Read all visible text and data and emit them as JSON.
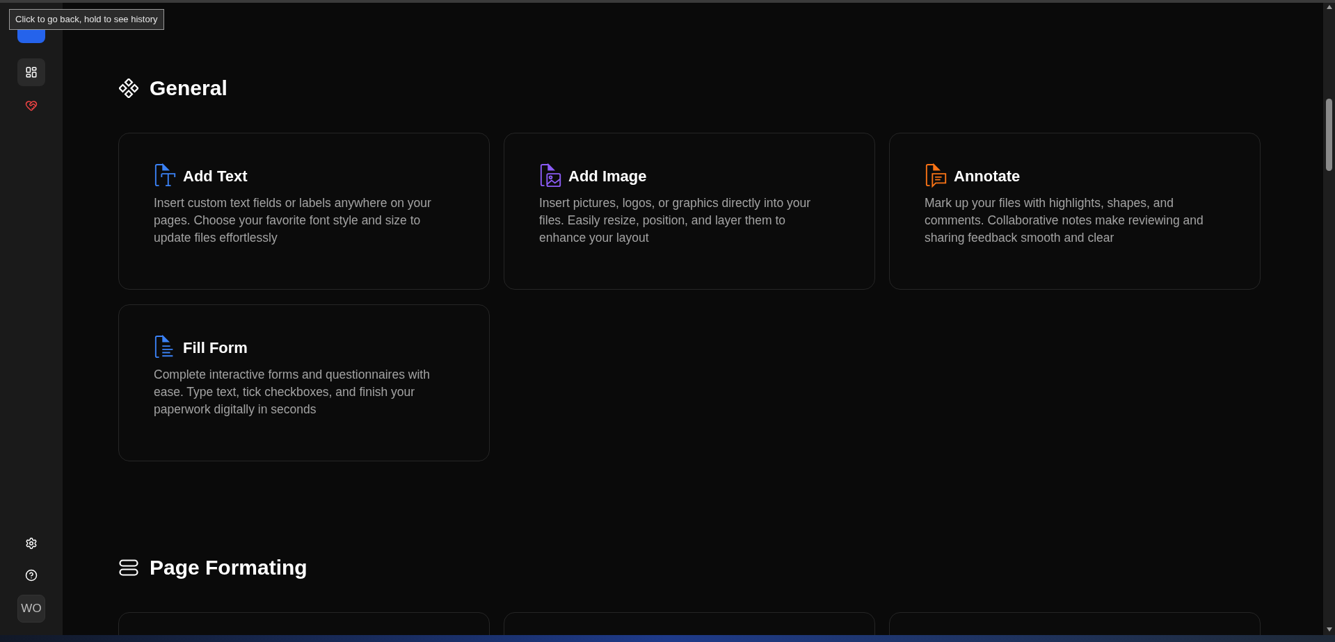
{
  "tooltip": "Click to go back, hold to see history",
  "sidebar": {
    "nav": [
      {
        "kind": "grid",
        "selected": true
      },
      {
        "kind": "heart",
        "selected": false
      }
    ],
    "bottom": [
      {
        "kind": "settings"
      },
      {
        "kind": "help"
      }
    ],
    "profile": "WO"
  },
  "sections": [
    {
      "title": "General",
      "kind": "diamonds",
      "cards": [
        {
          "kind": "text",
          "color": "#3b82f6",
          "title": "Add Text",
          "description": "Insert custom text fields or labels anywhere on your pages. Choose your favorite font style and size to update files effortlessly"
        },
        {
          "kind": "image",
          "color": "#8b5cf6",
          "title": "Add Image",
          "description": "Insert pictures, logos, or graphics directly into your files. Easily resize, position, and layer them to enhance your layout"
        },
        {
          "kind": "comment",
          "color": "#f97316",
          "title": "Annotate",
          "description": "Mark up your files with highlights, shapes, and comments. Collaborative notes make reviewing and sharing feedback smooth and clear"
        },
        {
          "kind": "form",
          "color": "#3b82f6",
          "title": "Fill Form",
          "description": "Complete interactive forms and questionnaires with ease. Type text, tick checkboxes, and finish your paperwork digitally in seconds"
        }
      ]
    },
    {
      "title": "Page Formating",
      "kind": "rows",
      "cards": [
        {
          "kind": "blank"
        },
        {
          "kind": "blank"
        },
        {
          "kind": "blank"
        }
      ]
    }
  ]
}
